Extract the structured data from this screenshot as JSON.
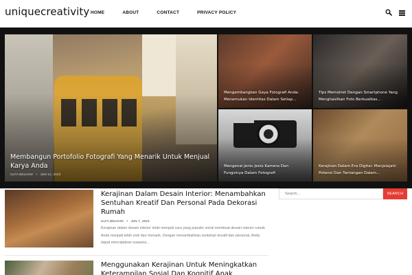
{
  "site": {
    "logo": "uniquecreativity"
  },
  "nav": {
    "items": [
      "HOME",
      "ABOUT",
      "CONTACT",
      "PRIVACY POLICY"
    ]
  },
  "header_icons": {
    "search": "search-icon",
    "menu": "hamburger-menu-icon"
  },
  "featured": {
    "main": {
      "title": "Membangun Portofolio Fotografi Yang Menarik Untuk Menjual Karya Anda",
      "author": "ULFA BELVANI",
      "date": "JUN 12, 2023"
    },
    "tiles": [
      {
        "title": "Mengembangkan Gaya Fotografi Anda: Menemukan Identitas Dalam Setiap..."
      },
      {
        "title": "Tips Memotret Dengan Smartphone Yang Menghasilkan Foto Berkualitas..."
      },
      {
        "title": "Mengenal Jenis-Jenis Kamera Dan Fungsinya Dalam Fotografi"
      },
      {
        "title": "Kerajinan Dalam Era Digital: Menjelajahi Potensi Dan Tantangan Dalam..."
      }
    ]
  },
  "posts": [
    {
      "title": "Kerajinan Dalam Desain Interior: Menambahkan Sentuhan Kreatif Dan Personal Pada Dekorasi Rumah",
      "author": "ULFA BELVANI",
      "date": "JUN 7, 2023",
      "excerpt": "Kerajinan dalam desain interior telah menjadi cara yang populer untuk membuat desain interior rumah Anda menjadi lebih unik dan menarik. Dengan menambahkan sentuhan kreatif dan personal, Anda dapat menciptakan suasana..."
    },
    {
      "title": "Menggunakan Kerajinan Untuk Meningkatkan Keterampilan Sosial Dan Kognitif Anak"
    }
  ],
  "sidebar": {
    "search_placeholder": "Search...",
    "search_button": "SEARCH"
  },
  "colors": {
    "accent": "#e43d33",
    "header_bg": "#ffffff",
    "featured_bg": "#111111"
  }
}
